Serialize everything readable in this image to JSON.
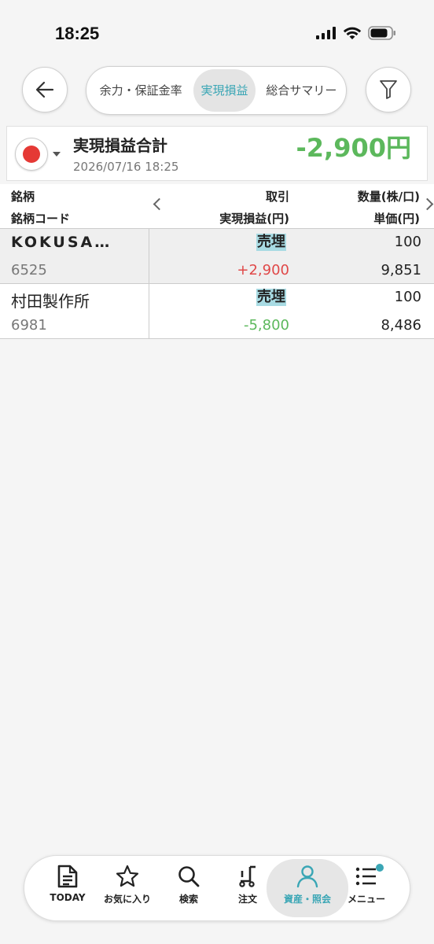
{
  "status_bar": {
    "time": "18:25"
  },
  "header": {
    "back_icon": "arrow-left-icon",
    "tabs": [
      {
        "label": "余力・保証金率",
        "active": false
      },
      {
        "label": "実現損益",
        "active": true
      },
      {
        "label": "総合サマリー",
        "active": false
      }
    ],
    "filter_icon": "filter-icon"
  },
  "summary": {
    "title": "実現損益合計",
    "date": "2026/07/16 18:25",
    "total": "-2,900円",
    "flag_color": "#e53935"
  },
  "table": {
    "headers": {
      "col1_top": "銘柄",
      "col1_bottom": "銘柄コード",
      "col2_top": "取引",
      "col2_bottom": "実現損益(円)",
      "col3_top": "数量(株/口)",
      "col3_bottom": "単価(円)"
    },
    "rows": [
      {
        "name": "KOKUSA…",
        "code": "6525",
        "trade": "売埋",
        "pl": "+2,900",
        "pl_color": "#e04848",
        "qty": "100",
        "price": "9,851"
      },
      {
        "name": "村田製作所",
        "code": "6981",
        "trade": "売埋",
        "pl": "-5,800",
        "pl_color": "#5cb85c",
        "qty": "100",
        "price": "8,486"
      }
    ]
  },
  "bottom_nav": {
    "items": [
      {
        "label": "TODAY",
        "icon": "document-icon"
      },
      {
        "label": "お気に入り",
        "icon": "star-icon"
      },
      {
        "label": "検索",
        "icon": "search-icon"
      },
      {
        "label": "注文",
        "icon": "cart-icon"
      },
      {
        "label": "資産・照会",
        "icon": "person-icon",
        "active": true
      },
      {
        "label": "メニュー",
        "icon": "list-icon"
      }
    ]
  },
  "colors": {
    "accent": "#3aa6b5",
    "positive": "#e04848",
    "negative": "#5cb85c",
    "trade_highlight": "#a8dbe3"
  }
}
